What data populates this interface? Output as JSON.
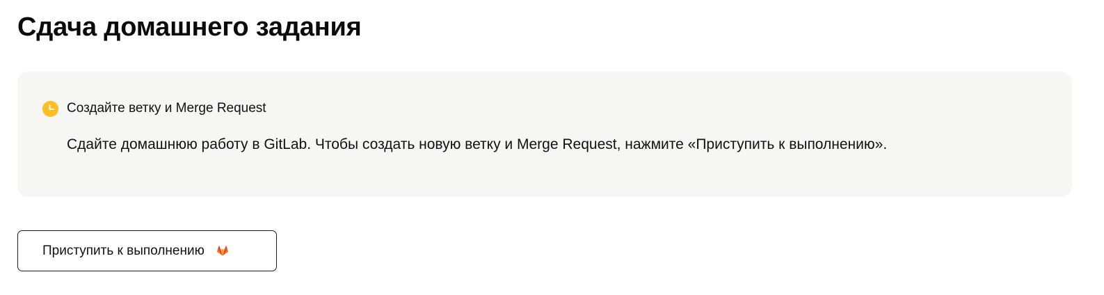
{
  "page": {
    "title": "Сдача домашнего задания"
  },
  "status_card": {
    "icon": "clock-icon",
    "icon_color": "#fbbf24",
    "status_label": "Создайте ветку и Merge Request",
    "description": "Сдайте домашнюю работу в GitLab. Чтобы создать новую ветку и Merge Request, нажмите «Приступить к выполнению»."
  },
  "start_button": {
    "label": "Приступить к выполнению",
    "icon": "gitlab-icon"
  },
  "colors": {
    "card_background": "#f6f6f4",
    "text": "#111111",
    "status_icon": "#fbbf24",
    "gitlab_orange": "#e24329"
  }
}
